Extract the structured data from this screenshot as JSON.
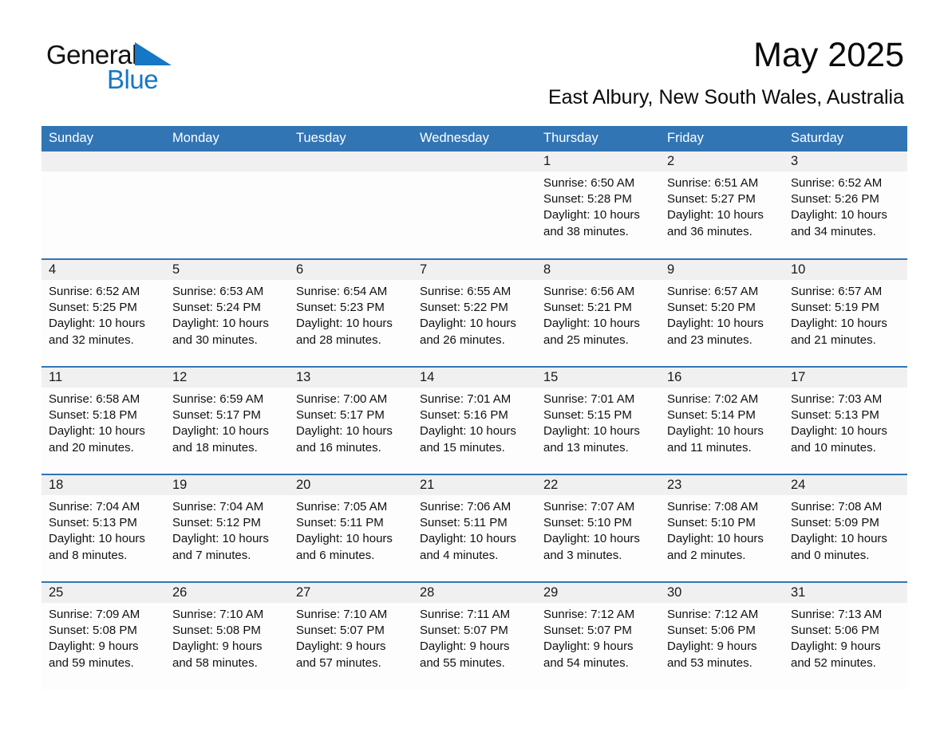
{
  "brand": {
    "name_dark": "General",
    "name_light": "Blue",
    "triangle_color": "#1577c6",
    "icon": "blue-triangle-icon"
  },
  "header": {
    "title": "May 2025",
    "subtitle": "East Albury, New South Wales, Australia"
  },
  "theme": {
    "header_blue": "#3275b4",
    "row_divider_blue": "#3275b4",
    "daynum_band": "#f0f0f0",
    "cell_background": "#fdfdfd",
    "brand_blue": "#1577c6"
  },
  "calendar": {
    "weekday_headers": [
      "Sunday",
      "Monday",
      "Tuesday",
      "Wednesday",
      "Thursday",
      "Friday",
      "Saturday"
    ],
    "labels": {
      "sunrise": "Sunrise:",
      "sunset": "Sunset:",
      "daylight": "Daylight:"
    },
    "weeks": [
      [
        {
          "day": "",
          "empty": true
        },
        {
          "day": "",
          "empty": true
        },
        {
          "day": "",
          "empty": true
        },
        {
          "day": "",
          "empty": true
        },
        {
          "day": "1",
          "sunrise": "Sunrise: 6:50 AM",
          "sunset": "Sunset: 5:28 PM",
          "daylight_l1": "Daylight: 10 hours",
          "daylight_l2": "and 38 minutes."
        },
        {
          "day": "2",
          "sunrise": "Sunrise: 6:51 AM",
          "sunset": "Sunset: 5:27 PM",
          "daylight_l1": "Daylight: 10 hours",
          "daylight_l2": "and 36 minutes."
        },
        {
          "day": "3",
          "sunrise": "Sunrise: 6:52 AM",
          "sunset": "Sunset: 5:26 PM",
          "daylight_l1": "Daylight: 10 hours",
          "daylight_l2": "and 34 minutes."
        }
      ],
      [
        {
          "day": "4",
          "sunrise": "Sunrise: 6:52 AM",
          "sunset": "Sunset: 5:25 PM",
          "daylight_l1": "Daylight: 10 hours",
          "daylight_l2": "and 32 minutes."
        },
        {
          "day": "5",
          "sunrise": "Sunrise: 6:53 AM",
          "sunset": "Sunset: 5:24 PM",
          "daylight_l1": "Daylight: 10 hours",
          "daylight_l2": "and 30 minutes."
        },
        {
          "day": "6",
          "sunrise": "Sunrise: 6:54 AM",
          "sunset": "Sunset: 5:23 PM",
          "daylight_l1": "Daylight: 10 hours",
          "daylight_l2": "and 28 minutes."
        },
        {
          "day": "7",
          "sunrise": "Sunrise: 6:55 AM",
          "sunset": "Sunset: 5:22 PM",
          "daylight_l1": "Daylight: 10 hours",
          "daylight_l2": "and 26 minutes."
        },
        {
          "day": "8",
          "sunrise": "Sunrise: 6:56 AM",
          "sunset": "Sunset: 5:21 PM",
          "daylight_l1": "Daylight: 10 hours",
          "daylight_l2": "and 25 minutes."
        },
        {
          "day": "9",
          "sunrise": "Sunrise: 6:57 AM",
          "sunset": "Sunset: 5:20 PM",
          "daylight_l1": "Daylight: 10 hours",
          "daylight_l2": "and 23 minutes."
        },
        {
          "day": "10",
          "sunrise": "Sunrise: 6:57 AM",
          "sunset": "Sunset: 5:19 PM",
          "daylight_l1": "Daylight: 10 hours",
          "daylight_l2": "and 21 minutes."
        }
      ],
      [
        {
          "day": "11",
          "sunrise": "Sunrise: 6:58 AM",
          "sunset": "Sunset: 5:18 PM",
          "daylight_l1": "Daylight: 10 hours",
          "daylight_l2": "and 20 minutes."
        },
        {
          "day": "12",
          "sunrise": "Sunrise: 6:59 AM",
          "sunset": "Sunset: 5:17 PM",
          "daylight_l1": "Daylight: 10 hours",
          "daylight_l2": "and 18 minutes."
        },
        {
          "day": "13",
          "sunrise": "Sunrise: 7:00 AM",
          "sunset": "Sunset: 5:17 PM",
          "daylight_l1": "Daylight: 10 hours",
          "daylight_l2": "and 16 minutes."
        },
        {
          "day": "14",
          "sunrise": "Sunrise: 7:01 AM",
          "sunset": "Sunset: 5:16 PM",
          "daylight_l1": "Daylight: 10 hours",
          "daylight_l2": "and 15 minutes."
        },
        {
          "day": "15",
          "sunrise": "Sunrise: 7:01 AM",
          "sunset": "Sunset: 5:15 PM",
          "daylight_l1": "Daylight: 10 hours",
          "daylight_l2": "and 13 minutes."
        },
        {
          "day": "16",
          "sunrise": "Sunrise: 7:02 AM",
          "sunset": "Sunset: 5:14 PM",
          "daylight_l1": "Daylight: 10 hours",
          "daylight_l2": "and 11 minutes."
        },
        {
          "day": "17",
          "sunrise": "Sunrise: 7:03 AM",
          "sunset": "Sunset: 5:13 PM",
          "daylight_l1": "Daylight: 10 hours",
          "daylight_l2": "and 10 minutes."
        }
      ],
      [
        {
          "day": "18",
          "sunrise": "Sunrise: 7:04 AM",
          "sunset": "Sunset: 5:13 PM",
          "daylight_l1": "Daylight: 10 hours",
          "daylight_l2": "and 8 minutes."
        },
        {
          "day": "19",
          "sunrise": "Sunrise: 7:04 AM",
          "sunset": "Sunset: 5:12 PM",
          "daylight_l1": "Daylight: 10 hours",
          "daylight_l2": "and 7 minutes."
        },
        {
          "day": "20",
          "sunrise": "Sunrise: 7:05 AM",
          "sunset": "Sunset: 5:11 PM",
          "daylight_l1": "Daylight: 10 hours",
          "daylight_l2": "and 6 minutes."
        },
        {
          "day": "21",
          "sunrise": "Sunrise: 7:06 AM",
          "sunset": "Sunset: 5:11 PM",
          "daylight_l1": "Daylight: 10 hours",
          "daylight_l2": "and 4 minutes."
        },
        {
          "day": "22",
          "sunrise": "Sunrise: 7:07 AM",
          "sunset": "Sunset: 5:10 PM",
          "daylight_l1": "Daylight: 10 hours",
          "daylight_l2": "and 3 minutes."
        },
        {
          "day": "23",
          "sunrise": "Sunrise: 7:08 AM",
          "sunset": "Sunset: 5:10 PM",
          "daylight_l1": "Daylight: 10 hours",
          "daylight_l2": "and 2 minutes."
        },
        {
          "day": "24",
          "sunrise": "Sunrise: 7:08 AM",
          "sunset": "Sunset: 5:09 PM",
          "daylight_l1": "Daylight: 10 hours",
          "daylight_l2": "and 0 minutes."
        }
      ],
      [
        {
          "day": "25",
          "sunrise": "Sunrise: 7:09 AM",
          "sunset": "Sunset: 5:08 PM",
          "daylight_l1": "Daylight: 9 hours",
          "daylight_l2": "and 59 minutes."
        },
        {
          "day": "26",
          "sunrise": "Sunrise: 7:10 AM",
          "sunset": "Sunset: 5:08 PM",
          "daylight_l1": "Daylight: 9 hours",
          "daylight_l2": "and 58 minutes."
        },
        {
          "day": "27",
          "sunrise": "Sunrise: 7:10 AM",
          "sunset": "Sunset: 5:07 PM",
          "daylight_l1": "Daylight: 9 hours",
          "daylight_l2": "and 57 minutes."
        },
        {
          "day": "28",
          "sunrise": "Sunrise: 7:11 AM",
          "sunset": "Sunset: 5:07 PM",
          "daylight_l1": "Daylight: 9 hours",
          "daylight_l2": "and 55 minutes."
        },
        {
          "day": "29",
          "sunrise": "Sunrise: 7:12 AM",
          "sunset": "Sunset: 5:07 PM",
          "daylight_l1": "Daylight: 9 hours",
          "daylight_l2": "and 54 minutes."
        },
        {
          "day": "30",
          "sunrise": "Sunrise: 7:12 AM",
          "sunset": "Sunset: 5:06 PM",
          "daylight_l1": "Daylight: 9 hours",
          "daylight_l2": "and 53 minutes."
        },
        {
          "day": "31",
          "sunrise": "Sunrise: 7:13 AM",
          "sunset": "Sunset: 5:06 PM",
          "daylight_l1": "Daylight: 9 hours",
          "daylight_l2": "and 52 minutes."
        }
      ]
    ]
  }
}
